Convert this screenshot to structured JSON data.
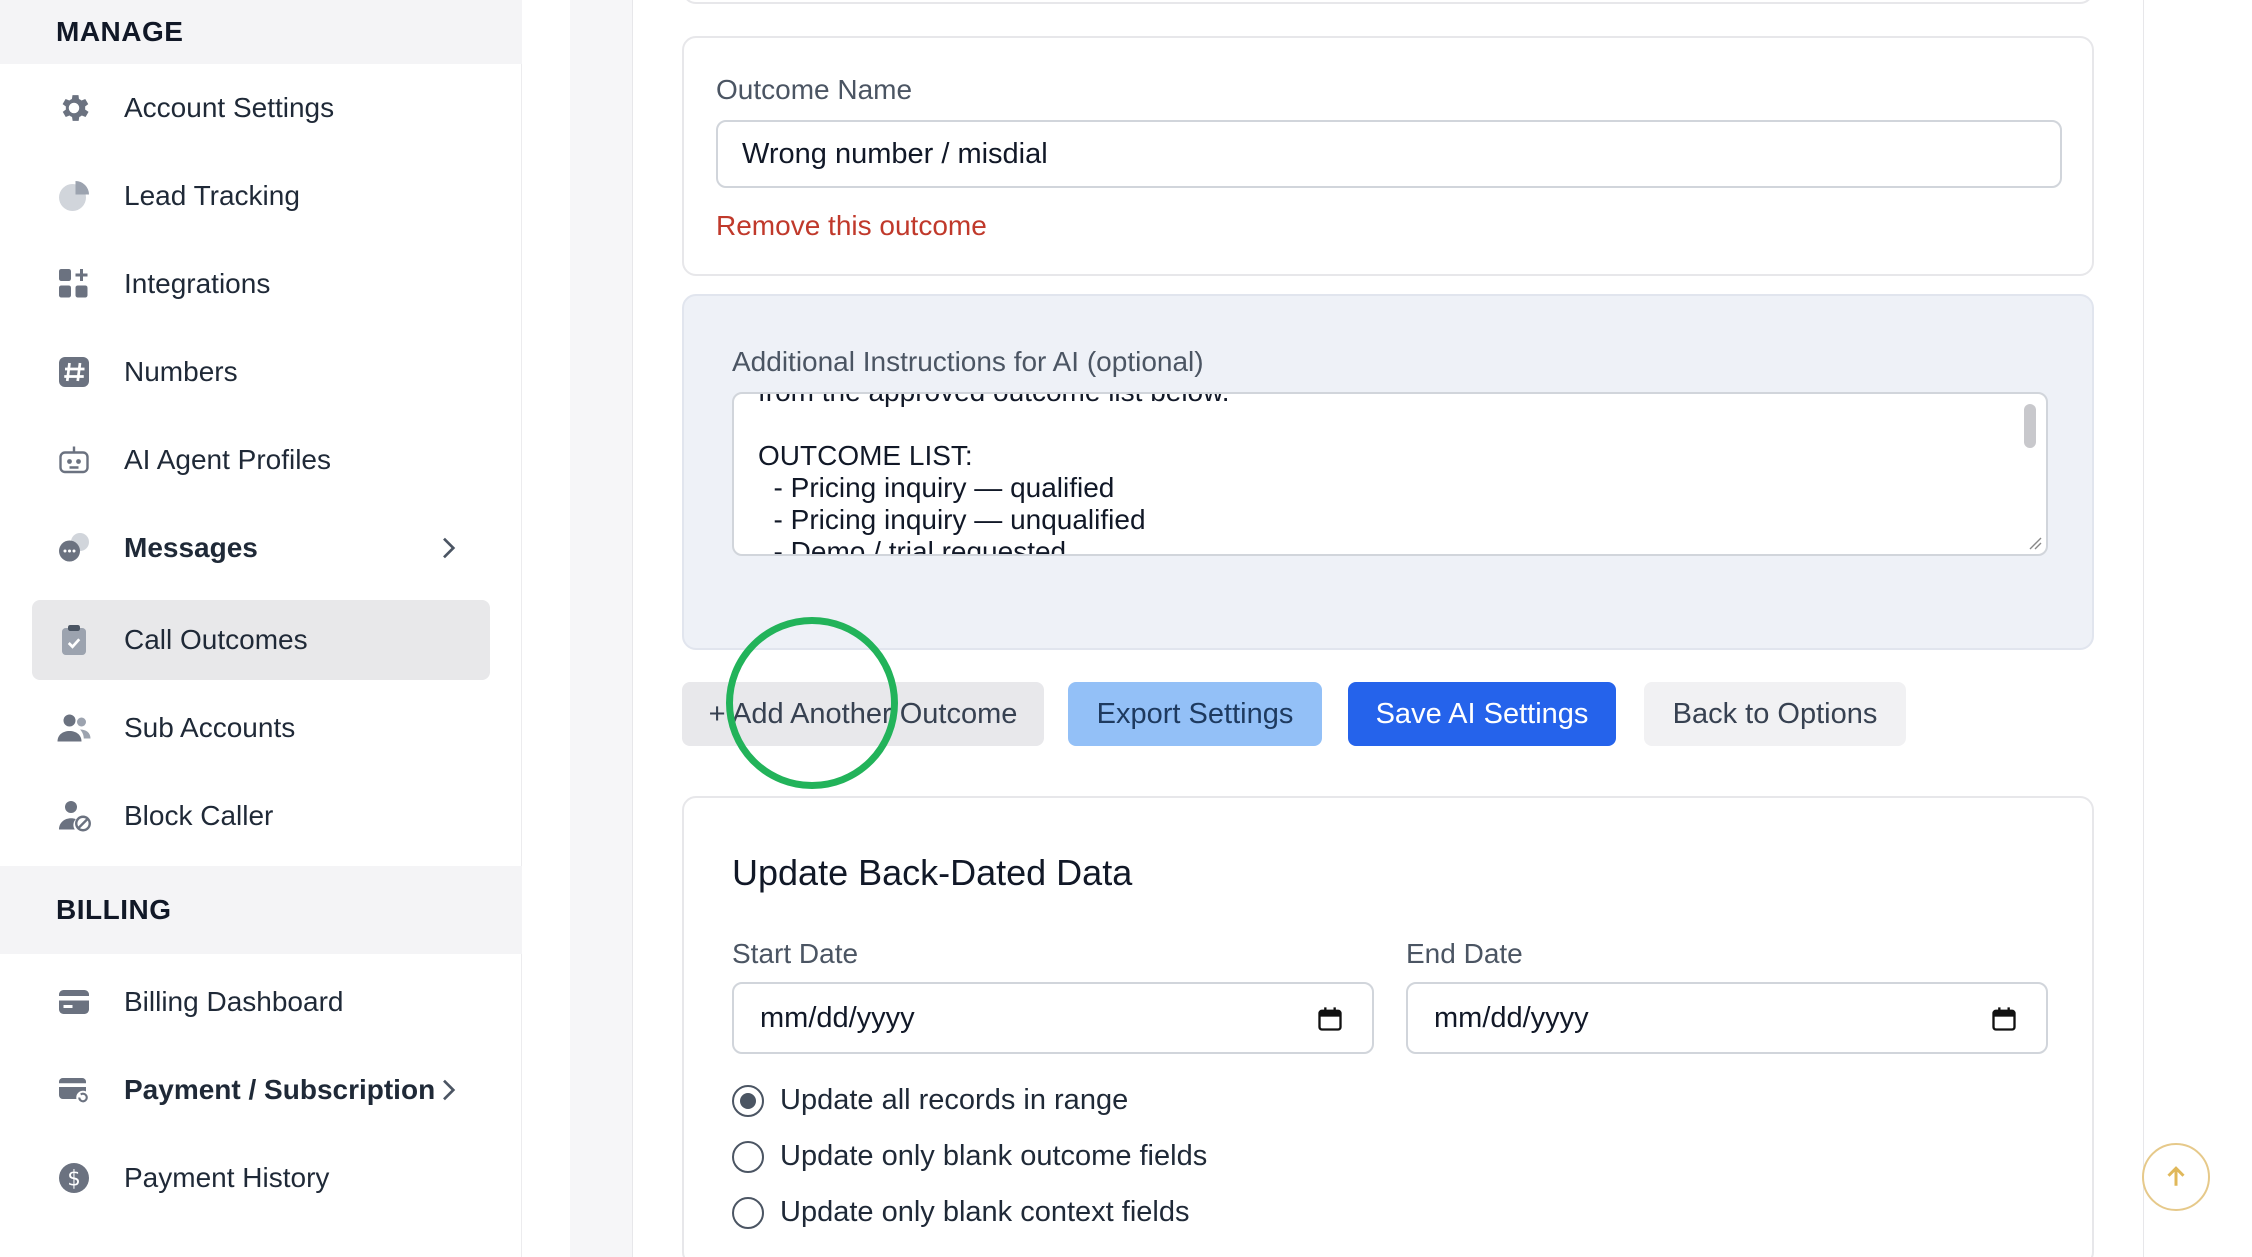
{
  "sidebar": {
    "manage_heading": "MANAGE",
    "billing_heading": "BILLING",
    "manage_items": [
      {
        "label": "Account Settings",
        "icon": "gear-icon"
      },
      {
        "label": "Lead Tracking",
        "icon": "pie-chart-icon"
      },
      {
        "label": "Integrations",
        "icon": "grid-plus-icon"
      },
      {
        "label": "Numbers",
        "icon": "hash-icon"
      },
      {
        "label": "AI Agent Profiles",
        "icon": "robot-icon"
      },
      {
        "label": "Messages",
        "icon": "chat-bubbles-icon"
      },
      {
        "label": "Call Outcomes",
        "icon": "clipboard-check-icon",
        "active": true
      },
      {
        "label": "Sub Accounts",
        "icon": "users-icon"
      },
      {
        "label": "Block Caller",
        "icon": "user-block-icon"
      }
    ],
    "billing_items": [
      {
        "label": "Billing Dashboard",
        "icon": "credit-card-icon"
      },
      {
        "label": "Payment / Subscription",
        "icon": "card-refresh-icon"
      },
      {
        "label": "Payment History",
        "icon": "dollar-circle-icon"
      }
    ]
  },
  "outcome": {
    "label": "Outcome Name",
    "value": "Wrong number / misdial",
    "remove_label": "Remove this outcome"
  },
  "ai": {
    "label": "Additional Instructions for AI (optional)",
    "text": "from the approved outcome list below.\n\nOUTCOME LIST:\n  - Pricing inquiry — qualified\n  - Pricing inquiry — unqualified\n  - Demo / trial requested"
  },
  "actions": {
    "add": "+ Add Another Outcome",
    "export": "Export Settings",
    "save": "Save AI Settings",
    "back": "Back to Options"
  },
  "backdated": {
    "title": "Update Back-Dated Data",
    "start_label": "Start Date",
    "end_label": "End Date",
    "start_placeholder": "mm/dd/yyyy",
    "end_placeholder": "mm/dd/yyyy",
    "options": [
      {
        "label": "Update all records in range",
        "checked": true
      },
      {
        "label": "Update only blank outcome fields",
        "checked": false
      },
      {
        "label": "Update only blank context fields",
        "checked": false
      }
    ]
  },
  "colors": {
    "primary": "#2563eb",
    "export": "#93c0f7",
    "danger": "#c0392b",
    "click_ring": "#22b35a"
  }
}
